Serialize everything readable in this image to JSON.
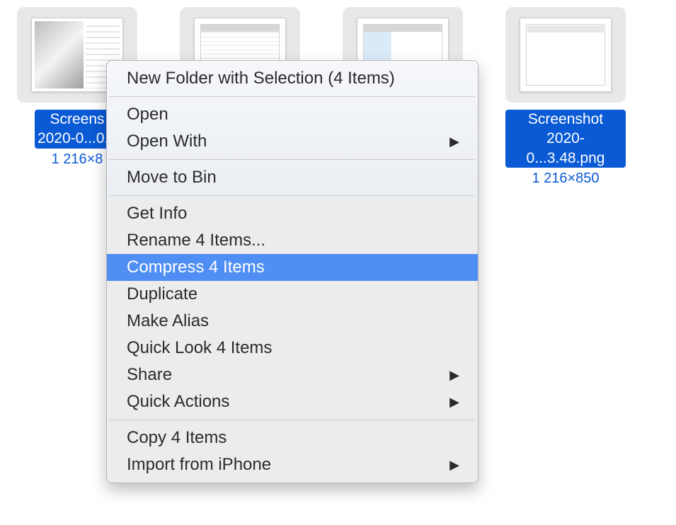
{
  "files": [
    {
      "name": "Screens\n2020-0...0.5",
      "dims": "1 216×8"
    },
    {
      "name": "",
      "dims": ""
    },
    {
      "name": "",
      "dims": ""
    },
    {
      "name": "Screenshot\n2020-0...3.48.png",
      "dims": "1 216×850"
    }
  ],
  "menu": {
    "new_folder": "New Folder with Selection (4 Items)",
    "open": "Open",
    "open_with": "Open With",
    "move_to_bin": "Move to Bin",
    "get_info": "Get Info",
    "rename": "Rename 4 Items...",
    "compress": "Compress 4 Items",
    "duplicate": "Duplicate",
    "make_alias": "Make Alias",
    "quick_look": "Quick Look 4 Items",
    "share": "Share",
    "quick_actions": "Quick Actions",
    "copy": "Copy 4 Items",
    "import": "Import from iPhone"
  }
}
